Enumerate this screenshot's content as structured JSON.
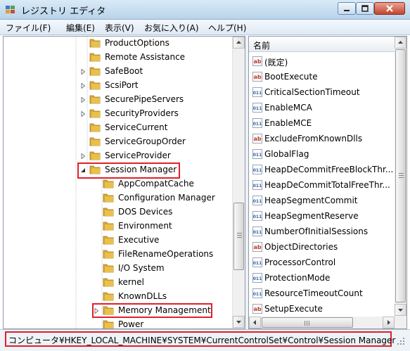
{
  "window": {
    "title": "レジストリ エディタ",
    "controls": [
      "minimize",
      "maximize",
      "close"
    ]
  },
  "menu": [
    "ファイル(F)",
    "編集(E)",
    "表示(V)",
    "お気に入り(A)",
    "ヘルプ(H)"
  ],
  "tree": {
    "items": [
      {
        "label": "ProductOptions",
        "expander": false,
        "highlighted": false
      },
      {
        "label": "Remote Assistance",
        "expander": false,
        "highlighted": false
      },
      {
        "label": "SafeBoot",
        "expander": true,
        "highlighted": false
      },
      {
        "label": "ScsiPort",
        "expander": true,
        "highlighted": false
      },
      {
        "label": "SecurePipeServers",
        "expander": true,
        "highlighted": false
      },
      {
        "label": "SecurityProviders",
        "expander": true,
        "highlighted": false
      },
      {
        "label": "ServiceCurrent",
        "expander": false,
        "highlighted": false
      },
      {
        "label": "ServiceGroupOrder",
        "expander": false,
        "highlighted": false
      },
      {
        "label": "ServiceProvider",
        "expander": true,
        "highlighted": false
      },
      {
        "label": "Session Manager",
        "expander": "expanded",
        "highlighted": true
      },
      {
        "label": "AppCompatCache",
        "expander": false,
        "highlighted": false
      },
      {
        "label": "Configuration Manager",
        "expander": false,
        "highlighted": false
      },
      {
        "label": "DOS Devices",
        "expander": false,
        "highlighted": false
      },
      {
        "label": "Environment",
        "expander": false,
        "highlighted": false
      },
      {
        "label": "Executive",
        "expander": false,
        "highlighted": false
      },
      {
        "label": "FileRenameOperations",
        "expander": false,
        "highlighted": false
      },
      {
        "label": "I/O System",
        "expander": false,
        "highlighted": false
      },
      {
        "label": "kernel",
        "expander": false,
        "highlighted": false
      },
      {
        "label": "KnownDLLs",
        "expander": false,
        "highlighted": false
      },
      {
        "label": "Memory Management",
        "expander": true,
        "highlighted": true
      },
      {
        "label": "Power",
        "expander": false,
        "highlighted": false
      }
    ]
  },
  "values": {
    "column_header": "名前",
    "items": [
      {
        "name": "(既定)",
        "icon": "string-value-icon"
      },
      {
        "name": "BootExecute",
        "icon": "string-value-icon"
      },
      {
        "name": "CriticalSectionTimeout",
        "icon": "binary-value-icon"
      },
      {
        "name": "EnableMCA",
        "icon": "binary-value-icon"
      },
      {
        "name": "EnableMCE",
        "icon": "binary-value-icon"
      },
      {
        "name": "ExcludeFromKnownDlls",
        "icon": "string-value-icon"
      },
      {
        "name": "GlobalFlag",
        "icon": "binary-value-icon"
      },
      {
        "name": "HeapDeCommitFreeBlockThr...",
        "icon": "binary-value-icon"
      },
      {
        "name": "HeapDeCommitTotalFreeThr...",
        "icon": "binary-value-icon"
      },
      {
        "name": "HeapSegmentCommit",
        "icon": "binary-value-icon"
      },
      {
        "name": "HeapSegmentReserve",
        "icon": "binary-value-icon"
      },
      {
        "name": "NumberOfInitialSessions",
        "icon": "binary-value-icon"
      },
      {
        "name": "ObjectDirectories",
        "icon": "string-value-icon"
      },
      {
        "name": "ProcessorControl",
        "icon": "binary-value-icon"
      },
      {
        "name": "ProtectionMode",
        "icon": "binary-value-icon"
      },
      {
        "name": "ResourceTimeoutCount",
        "icon": "binary-value-icon"
      },
      {
        "name": "SetupExecute",
        "icon": "string-value-icon"
      }
    ]
  },
  "status": {
    "path": "コンピュータ¥HKEY_LOCAL_MACHINE¥SYSTEM¥CurrentControlSet¥Control¥Session Manager"
  },
  "colors": {
    "highlight_box": "#e0202a",
    "folder": "#e9c04a",
    "string_icon": "#c0392b",
    "binary_icon": "#2f5fb0"
  }
}
